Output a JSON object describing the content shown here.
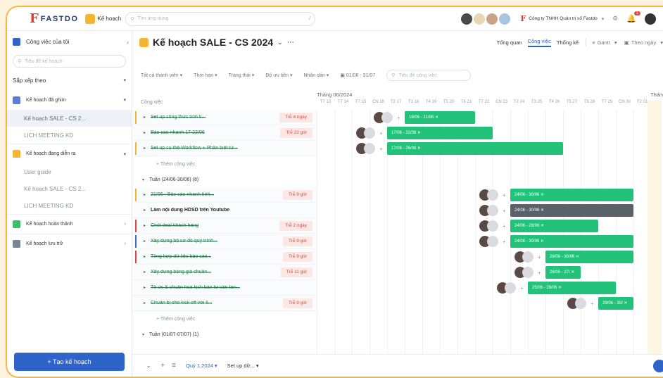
{
  "topbar": {
    "brand": "FASTDO",
    "module_label": "Kế hoạch",
    "search_placeholder": "Tìm ứng dụng",
    "company": "Công ty TNHH Quản trị số Fastdo",
    "notif_count": "1"
  },
  "sidebar": {
    "my_work": "Công việc của tôi",
    "search_placeholder": "Tiêu đề kế hoạch",
    "sort_label": "Sắp xếp theo",
    "groups": [
      {
        "label": "Kế hoạch đã ghim",
        "color": "#5b7fd6",
        "items": [
          "Kế hoạch SALE - CS 2...",
          "LỊCH MEETING KD"
        ]
      },
      {
        "label": "Kế hoạch đang diễn ra",
        "color": "#f5b431",
        "items": [
          "User guide",
          "Kế hoạch SALE - CS 2...",
          "LỊCH MEETING KD"
        ]
      },
      {
        "label": "Kế hoạch hoàn thành",
        "color": "#3cbf6a",
        "items": []
      },
      {
        "label": "Kế hoạch lưu trữ",
        "color": "#7a8594",
        "items": []
      }
    ],
    "add_button": "+ Tạo kế hoạch"
  },
  "header": {
    "title": "Kế hoạch SALE - CS 2024",
    "tabs": [
      "Tổng quan",
      "Công việc",
      "Thống kê"
    ],
    "active_tab": "Công việc",
    "view": "Gantt",
    "scale": "Theo ngày"
  },
  "filters": {
    "members": "Tất cả thành viên",
    "deadline": "Thời hạn",
    "status": "Trạng thái",
    "priority": "Độ ưu tiên",
    "label": "Nhãn dán",
    "date_range": "01/06 - 31/07",
    "search_placeholder": "Tiêu đề công việc"
  },
  "gantt": {
    "column_header": "Công việc",
    "month_label": "Tháng 06/2024",
    "next_month_label": "Tháng",
    "add_task": "+ Thêm công việc",
    "week_header": "Tuần (24/06-30/06) (8)",
    "week_footer": "Tuần (01/07-07/07) (1)",
    "days": [
      {
        "wd": "T7",
        "d": "13"
      },
      {
        "wd": "T7",
        "d": "14"
      },
      {
        "wd": "T7",
        "d": "15"
      },
      {
        "wd": "CN",
        "d": "16"
      },
      {
        "wd": "T2",
        "d": "17"
      },
      {
        "wd": "T3",
        "d": "18"
      },
      {
        "wd": "T4",
        "d": "19"
      },
      {
        "wd": "T5",
        "d": "20"
      },
      {
        "wd": "T6",
        "d": "21"
      },
      {
        "wd": "T7",
        "d": "22"
      },
      {
        "wd": "CN",
        "d": "23"
      },
      {
        "wd": "T2",
        "d": "24"
      },
      {
        "wd": "T3",
        "d": "25"
      },
      {
        "wd": "T4",
        "d": "26"
      },
      {
        "wd": "T5",
        "d": "27"
      },
      {
        "wd": "T6",
        "d": "28"
      },
      {
        "wd": "T7",
        "d": "29"
      },
      {
        "wd": "CN",
        "d": "30"
      },
      {
        "wd": "T2",
        "d": "01"
      }
    ],
    "group1": [
      {
        "name": "Set up công thức tính ti...",
        "late": "Trễ 4 ngày",
        "bar": "18/06 - 21/06",
        "done": true,
        "marker": "#f5b431",
        "expand": true
      },
      {
        "name": "Báo cáo nhanh 17-22/06",
        "late": "Trễ 22 giờ",
        "bar": "17/06 - 22/06",
        "done": true,
        "marker": "",
        "expand": true
      },
      {
        "name": "Set up cụ thể Workflow + Phân biệt từ...",
        "late": "",
        "bar": "17/06 - 26/06",
        "done": true,
        "marker": "#f5b431",
        "expand": true
      }
    ],
    "group2": [
      {
        "name": "21/06 - Báo cáo nhanh tình...",
        "late": "Trễ 9 giờ",
        "bar": "24/06 - 30/06",
        "done": true,
        "marker": "#f5b431",
        "color": "#23c27a"
      },
      {
        "name": "Làm nội dung HDSD trên Youtube",
        "late": "",
        "bar": "24/06 - 30/06",
        "done": false,
        "marker": "",
        "color": "#5b6169"
      },
      {
        "name": "Chốt deal khách hàng",
        "late": "Trễ 2 ngày",
        "bar": "24/06 - 28/06",
        "done": true,
        "marker": "#e04848",
        "color": "#23c27a"
      },
      {
        "name": "Xây dựng bộ sơ đồ quy trình...",
        "late": "Trễ 9 giờ",
        "bar": "24/06 - 30/06",
        "done": true,
        "marker": "#3b6fd8",
        "color": "#23c27a"
      },
      {
        "name": "Tổng hợp dữ liệu báo cáo...",
        "late": "Trễ 9 giờ",
        "bar": "26/06 - 30/06",
        "done": true,
        "marker": "#e04848",
        "color": "#23c27a"
      },
      {
        "name": "Xây dựng bảng giá chuẩn...",
        "late": "Trễ 11 giờ",
        "bar": "26/06 - 27/",
        "done": true,
        "marker": "",
        "color": "#23c27a"
      },
      {
        "name": "Tổ ức & chuẩn hoá kịch bản tư vấn fan...",
        "late": "",
        "bar": "25/06 - 29/06",
        "done": true,
        "marker": "",
        "color": "#23c27a"
      },
      {
        "name": "Chuẩn bị cho kick off với ll...",
        "late": "Trễ 9 giờ",
        "bar": "29/06 - 30/",
        "done": true,
        "marker": "",
        "color": "#23c27a"
      }
    ]
  },
  "footer": {
    "quarter": "Quý 1.2024",
    "setup": "Set up dữ..."
  }
}
